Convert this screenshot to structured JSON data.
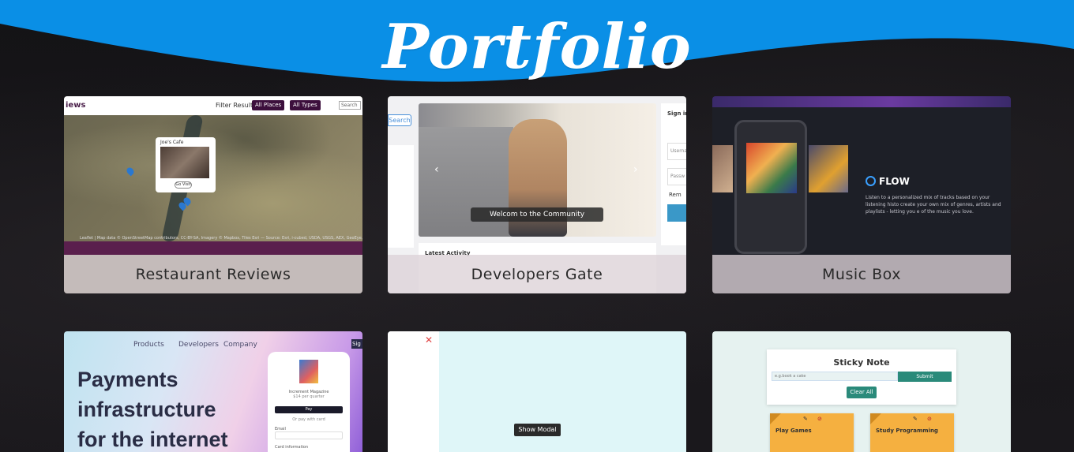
{
  "page": {
    "title": "Portfolio",
    "colors": {
      "accent": "#0a8fe6",
      "background": "#17161a",
      "caption_bg": "#dcd2d7"
    }
  },
  "projects": [
    {
      "caption": "Restaurant Reviews",
      "preview": {
        "brand": "iews",
        "filter_label": "Filter Results",
        "places": "All Places",
        "types": "All Types",
        "search_placeholder": "Search",
        "popup_title": "Joe's Cafe",
        "popup_button": "Go Visit",
        "credit": "Leaflet | Map data © OpenStreetMap contributors, CC-BY-SA, Imagery © Mapbox, Tiles Esri — Source: Esri, i-cubed, USDA, USGS, AEX, GeoEye, Getmapping, Aerogrid, IGN, IGP, UPR-EGP"
      }
    },
    {
      "caption": "Developers Gate",
      "preview": {
        "search": "Search",
        "welcome": "Welcom to the Community",
        "sign_in": "Sign in",
        "username": "Userna",
        "password": "Passw",
        "remember": "Rem",
        "activity": "Latest Activity"
      }
    },
    {
      "caption": "Music Box",
      "preview": {
        "brand": "FLOW",
        "description": "Listen to a personalized mix of tracks based on your listening histo create your own mix of genres, artists and playlists - letting you e of the music you love."
      }
    },
    {
      "caption": "",
      "preview": {
        "nav": [
          "Products",
          "Developers",
          "Company"
        ],
        "sign": "Sig",
        "headline": [
          "Payments",
          "infrastructure",
          "for the internet"
        ],
        "product": "Increment Magazine",
        "price": "$14 per quarter",
        "apple_pay": "Pay",
        "or_card": "Or pay with card",
        "email": "Email",
        "card_info": "Card information"
      }
    },
    {
      "caption": "",
      "preview": {
        "close": "✕",
        "show_modal": "Show Modal"
      }
    },
    {
      "caption": "",
      "preview": {
        "title": "Sticky Note",
        "input_placeholder": "e.g.book a cake",
        "submit": "Submit",
        "clear": "Clear All",
        "notes": [
          "Play Games",
          "Study Programming"
        ]
      }
    }
  ]
}
